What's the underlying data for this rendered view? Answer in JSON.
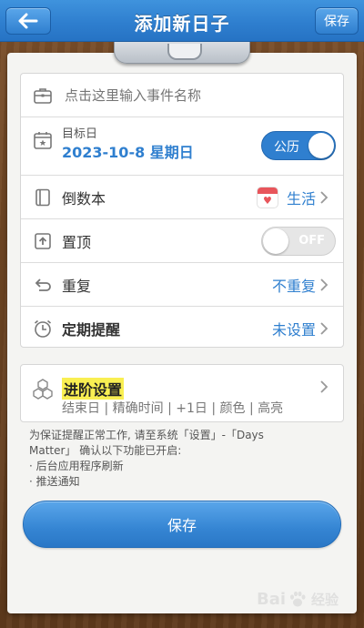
{
  "header": {
    "title": "添加新日子",
    "save_label": "保存"
  },
  "form": {
    "event_name_placeholder": "点击这里输入事件名称",
    "target_date_label": "目标日",
    "target_date_value": "2023-10-8 星期日",
    "calendar_toggle_label": "公历",
    "notebook_label": "倒数本",
    "notebook_value": "生活",
    "pin_label": "置顶",
    "pin_toggle_label": "OFF",
    "repeat_label": "重复",
    "repeat_value": "不重复",
    "reminder_label": "定期提醒",
    "reminder_value": "未设置"
  },
  "advanced": {
    "title": "进阶设置",
    "subtitle": "结束日 | 精确时间 | +1日 | 颜色 | 高亮"
  },
  "note": {
    "line1": "为保证提醒正常工作, 请至系统「设置」-「Days",
    "line2": "Matter」 确认以下功能已开启:",
    "line3": "· 后台应用程序刷新",
    "line4": "· 推送通知"
  },
  "footer": {
    "save_label": "保存"
  },
  "watermark": {
    "text": "Bai",
    "text2": "经验"
  },
  "colors": {
    "accent": "#2f7fcf",
    "highlight": "#f9ef52",
    "badge_red": "#e8555b"
  }
}
